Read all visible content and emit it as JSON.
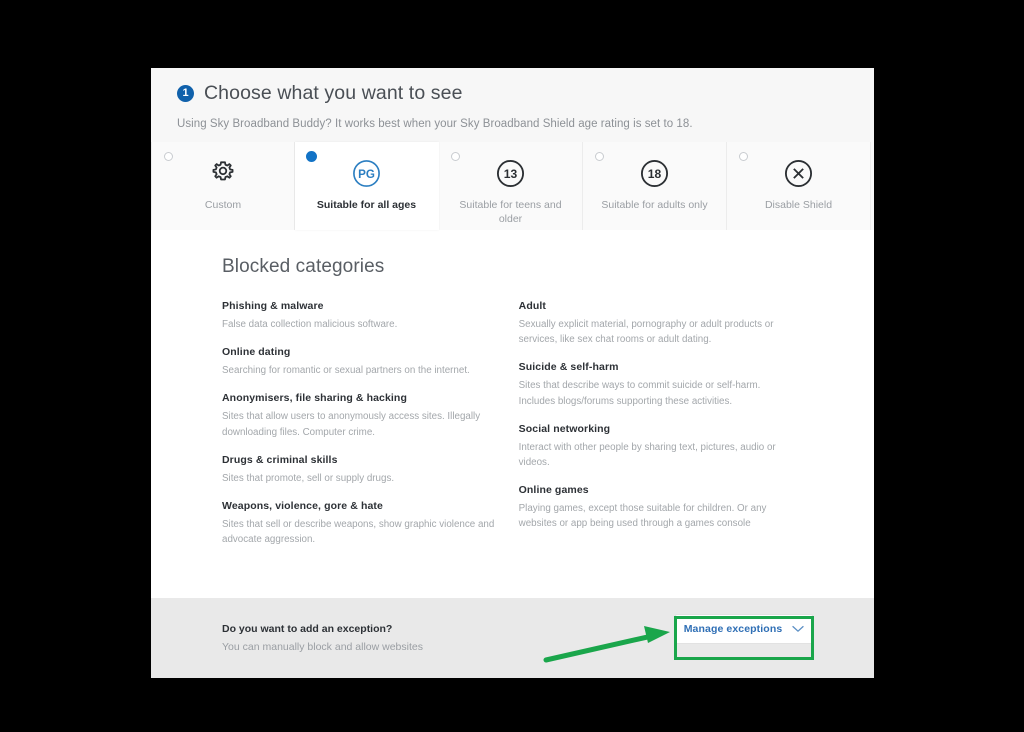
{
  "header": {
    "step_number": "1",
    "title": "Choose what you want to see",
    "subtitle": "Using Sky Broadband Buddy? It works best when your Sky Broadband Shield age rating is set to 18."
  },
  "rating_tabs": [
    {
      "label": "Custom",
      "icon": "gear-icon",
      "selected": false
    },
    {
      "label": "Suitable for all ages",
      "icon": "pg-rating-icon",
      "selected": true
    },
    {
      "label": "Suitable for teens and older",
      "icon": "13-rating-icon",
      "selected": false
    },
    {
      "label": "Suitable for adults only",
      "icon": "18-rating-icon",
      "selected": false
    },
    {
      "label": "Disable Shield",
      "icon": "x-circle-icon",
      "selected": false
    }
  ],
  "blocked": {
    "title": "Blocked categories",
    "left": [
      {
        "name": "Phishing & malware",
        "desc": "False data collection malicious software."
      },
      {
        "name": "Online dating",
        "desc": "Searching for romantic or sexual partners on the internet."
      },
      {
        "name": "Anonymisers, file sharing & hacking",
        "desc": "Sites that allow users to anonymously access sites. Illegally downloading files. Computer crime."
      },
      {
        "name": "Drugs & criminal skills",
        "desc": "Sites that promote, sell or supply drugs."
      },
      {
        "name": "Weapons, violence, gore & hate",
        "desc": "Sites that sell or describe weapons, show graphic violence and advocate aggression."
      }
    ],
    "right": [
      {
        "name": "Adult",
        "desc": "Sexually explicit material, pornography or adult products or services, like sex chat rooms or adult dating."
      },
      {
        "name": "Suicide & self-harm",
        "desc": "Sites that describe ways to commit suicide or self-harm. Includes blogs/forums supporting these activities."
      },
      {
        "name": "Social networking",
        "desc": "Interact with other people by sharing text, pictures, audio or videos."
      },
      {
        "name": "Online games",
        "desc": "Playing games, except those suitable for children. Or any websites or app being used through a games console"
      }
    ]
  },
  "footer": {
    "question": "Do you want to add an exception?",
    "subtitle": "You can manually block and allow websites",
    "manage_button_label": "Manage exceptions",
    "chevron_icon": "chevron-down-icon"
  },
  "annotations": {
    "highlight_color": "#1aa64b",
    "arrow_color": "#1aa64b",
    "arrow_icon": "green-pointer-arrow"
  },
  "colors": {
    "accent_blue": "#1273c6",
    "link_blue": "#2f6fb5",
    "page_background": "#000000",
    "card_background": "#ffffff",
    "header_background": "#f7f7f7",
    "footer_background": "#e9e9e9"
  }
}
